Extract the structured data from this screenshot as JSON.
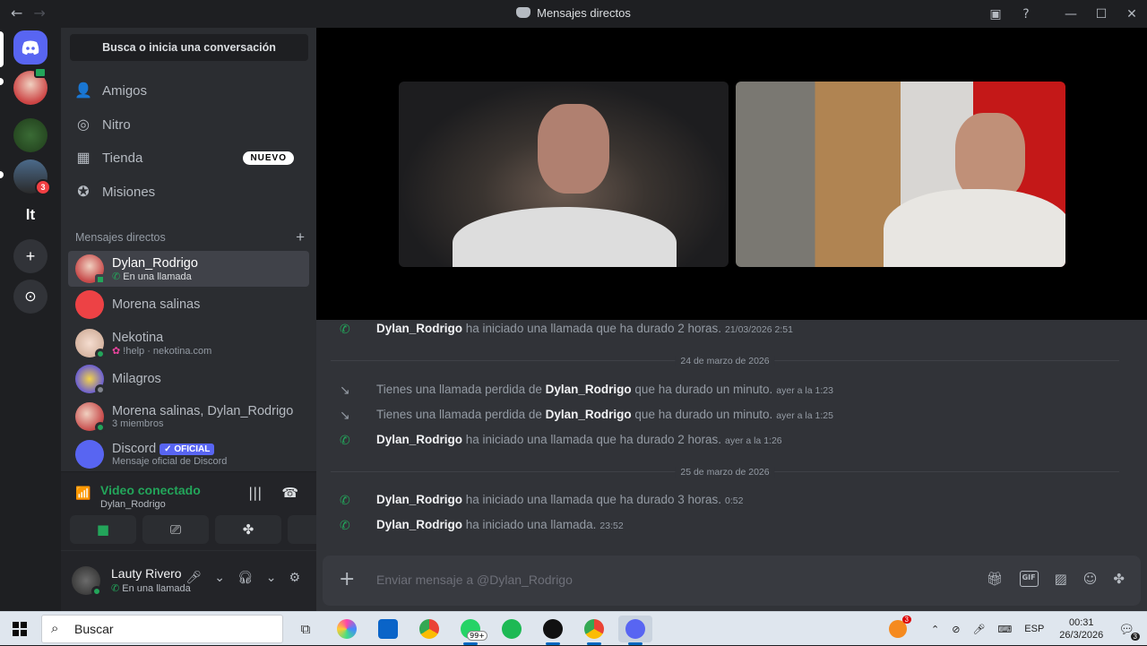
{
  "window": {
    "title": "Mensajes directos",
    "back_icon": "←",
    "forward_icon": "→",
    "minimize": "—",
    "maximize": "☐",
    "close": "✕"
  },
  "servers": {
    "items": [
      {
        "name": "discord-home",
        "label": ""
      },
      {
        "name": "server-avatar-1",
        "label": ""
      },
      {
        "name": "server-avatar-2",
        "label": ""
      },
      {
        "name": "server-avatar-3",
        "label": "",
        "badge": "3"
      },
      {
        "name": "server-lt",
        "label": "lt"
      },
      {
        "name": "add-server",
        "label": "+"
      },
      {
        "name": "explore",
        "label": "⊙"
      }
    ]
  },
  "sidebar": {
    "search_placeholder": "Busca o inicia una conversación",
    "nav": [
      {
        "label": "Amigos",
        "icon": "friends-icon"
      },
      {
        "label": "Nitro",
        "icon": "nitro-icon"
      },
      {
        "label": "Tienda",
        "icon": "shop-icon",
        "badge": "NUEVO"
      },
      {
        "label": "Misiones",
        "icon": "quests-icon"
      }
    ],
    "dm_header": "Mensajes directos",
    "dms": [
      {
        "name": "Dylan_Rodrigo",
        "sub": "En una llamada",
        "color": "#c74a4a",
        "status": "#23a55a"
      },
      {
        "name": "Morena salinas",
        "sub": "",
        "color": "#ed4245",
        "status": ""
      },
      {
        "name": "Nekotina",
        "sub": "!help · nekotina.com",
        "color": "#e8c6b8",
        "status": "#23a55a"
      },
      {
        "name": "Milagros",
        "sub": "",
        "color": "#6b5fd1",
        "status": "#80848e"
      },
      {
        "name": "Morena salinas, Dylan_Rodrigo",
        "sub": "3 miembros",
        "color": "#c74a4a",
        "status": ""
      },
      {
        "name": "Discord",
        "sub": "Mensaje oficial de Discord",
        "color": "#5865f2",
        "status": "",
        "tag": "✓ OFICIAL"
      }
    ]
  },
  "voice": {
    "title": "Video conectado",
    "channel": "Dylan_Rodrigo"
  },
  "user": {
    "name": "Lauty Rivero",
    "status": "En una llamada"
  },
  "messages": [
    {
      "type": "call",
      "who": "Dylan_Rodrigo",
      "text": "ha iniciado una llamada que ha durado 2 horas.",
      "time": "21/03/2026 2:51"
    },
    {
      "type": "divider",
      "text": "24 de marzo de 2026"
    },
    {
      "type": "missed",
      "pre": "Tienes una llamada perdida de",
      "who": "Dylan_Rodrigo",
      "text": "que ha durado un minuto.",
      "time": "ayer a la 1:23"
    },
    {
      "type": "missed",
      "pre": "Tienes una llamada perdida de",
      "who": "Dylan_Rodrigo",
      "text": "que ha durado un minuto.",
      "time": "ayer a la 1:25"
    },
    {
      "type": "call",
      "who": "Dylan_Rodrigo",
      "text": "ha iniciado una llamada que ha durado 2 horas.",
      "time": "ayer a la 1:26"
    },
    {
      "type": "divider",
      "text": "25 de marzo de 2026"
    },
    {
      "type": "call",
      "who": "Dylan_Rodrigo",
      "text": "ha iniciado una llamada que ha durado 3 horas.",
      "time": "0:52"
    },
    {
      "type": "call",
      "who": "Dylan_Rodrigo",
      "text": "ha iniciado una llamada.",
      "time": "23:52"
    }
  ],
  "composer": {
    "placeholder": "Enviar mensaje a @Dylan_Rodrigo",
    "gif": "GIF"
  },
  "taskbar": {
    "search": "Buscar",
    "whatsapp_badge": "99+",
    "lang": "ESP",
    "time": "00:31",
    "date": "26/3/2026",
    "notif_badge": "3",
    "tray_badge": "3"
  }
}
